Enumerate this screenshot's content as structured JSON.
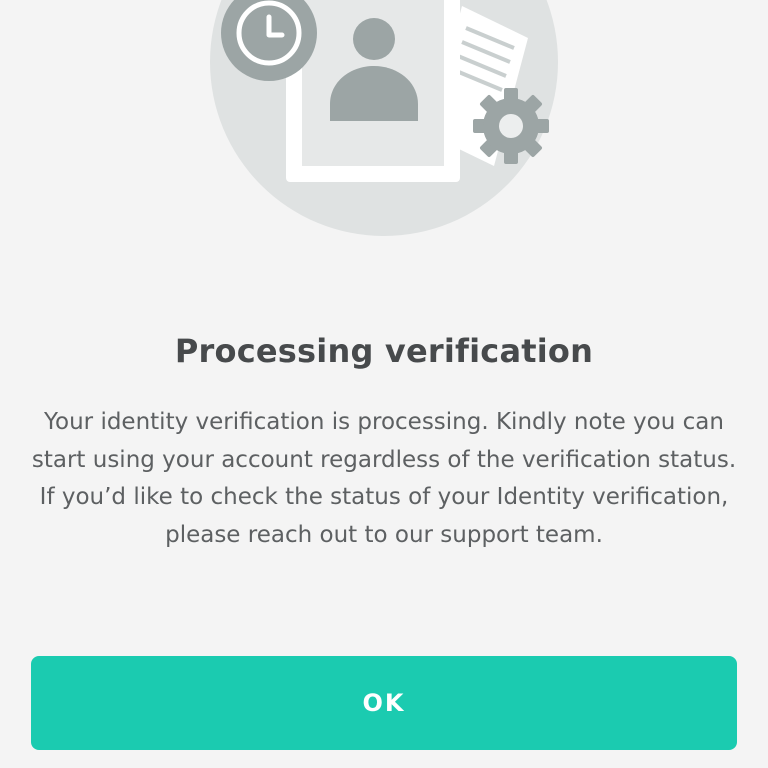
{
  "illustration": {
    "icons": [
      "clock-icon",
      "person-icon",
      "document-icon",
      "gear-icon"
    ]
  },
  "dialog": {
    "title": "Processing verification",
    "message": "Your identity verification is processing. Kindly note you can start using your account regardless of the verification status. If you’d like to check the status of your Identity verification, please reach out to our support team.",
    "ok_label": "OK"
  },
  "colors": {
    "background": "#f4f4f4",
    "accent": "#1bcbb0",
    "title_text": "#474a4c",
    "body_text": "#5d6062",
    "illustration_circle": "#dfe2e2",
    "illustration_icon": "#9ca5a5"
  }
}
